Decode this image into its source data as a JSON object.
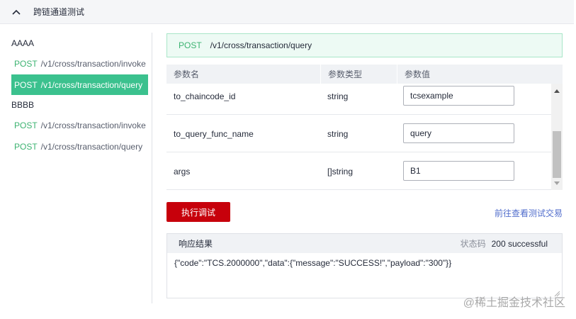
{
  "section": {
    "title": "跨链通道测试"
  },
  "sidebar": {
    "groups": [
      {
        "label": "AAAA",
        "items": [
          {
            "method": "POST",
            "path": "/v1/cross/transaction/invoke"
          },
          {
            "method": "POST",
            "path": "/v1/cross/transaction/query"
          }
        ]
      },
      {
        "label": "BBBB",
        "items": [
          {
            "method": "POST",
            "path": "/v1/cross/transaction/invoke"
          },
          {
            "method": "POST",
            "path": "/v1/cross/transaction/query"
          }
        ]
      }
    ],
    "active_item": "AAAA /v1/cross/transaction/query"
  },
  "endpoint": {
    "method": "POST",
    "path": "/v1/cross/transaction/query"
  },
  "params": {
    "headers": {
      "name": "参数名",
      "type": "参数类型",
      "value": "参数值"
    },
    "rows": [
      {
        "name": "to_chaincode_id",
        "type": "string",
        "value": "tcsexample"
      },
      {
        "name": "to_query_func_name",
        "type": "string",
        "value": "query"
      },
      {
        "name": "args",
        "type": "[]string",
        "value": "B1"
      }
    ]
  },
  "actions": {
    "run_label": "执行调试",
    "link_label": "前往查看测试交易"
  },
  "response": {
    "title": "响应结果",
    "status_label": "状态码",
    "status_value": "200 successful",
    "body": "{\"code\":\"TCS.2000000\",\"data\":{\"message\":\"SUCCESS!\",\"payload\":\"300\"}}"
  },
  "watermark": "@稀土掘金技术社区",
  "colors": {
    "accent": "#3bc18e",
    "primary_button": "#c7000b",
    "link": "#526ecc"
  }
}
